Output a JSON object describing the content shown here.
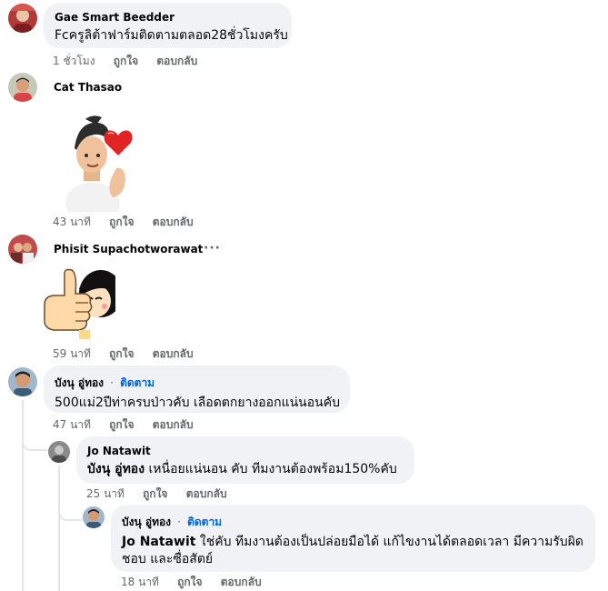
{
  "comments": [
    {
      "author": "Gae Smart Beedder",
      "text": "Fcครูลิต้าฟาร์มติดตามตลอด28ชั่วโมงครับ",
      "time": "1 ชั่วโมง",
      "like": "ถูกใจ",
      "reply": "ตอบกลับ"
    },
    {
      "author": "Cat Thasao",
      "sticker": "heart-hand-boy-sticker",
      "time": "43 นาที",
      "like": "ถูกใจ",
      "reply": "ตอบกลับ"
    },
    {
      "author": "Phisit Supachotworawat",
      "more": "···",
      "sticker": "thumbs-up-girl-sticker",
      "time": "59 นาที",
      "like": "ถูกใจ",
      "reply": "ตอบกลับ"
    },
    {
      "author": "บังนุ อู่ทอง",
      "sep": "·",
      "follow": "ติดตาม",
      "text": "500แม่2ปีท่าครบป่าวคับ เลือดตกยางออกแน่นอนคับ",
      "time": "47 นาที",
      "like": "ถูกใจ",
      "reply": "ตอบกลับ"
    },
    {
      "author": "Jo Natawit",
      "tag": "บังนุ อู่ทอง",
      "text": " เหนื่อยแน่นอน คับ ทีมงานต้องพร้อม150%คับ",
      "time": "25 นาที",
      "like": "ถูกใจ",
      "reply": "ตอบกลับ"
    },
    {
      "author": "บังนุ อู่ทอง",
      "sep": "·",
      "follow": "ติดตาม",
      "tag": "Jo Natawit",
      "text_line1": " ใช่คับ ทีมงานต้องเป็นปล่อยมือได้ แก้ไขงานได้ตลอดเวลา มีความรับผิด",
      "text_line2": "ชอบ และซื่อสัตย์",
      "time": "18 นาที",
      "like": "ถูกใจ",
      "reply": "ตอบกลับ"
    }
  ]
}
